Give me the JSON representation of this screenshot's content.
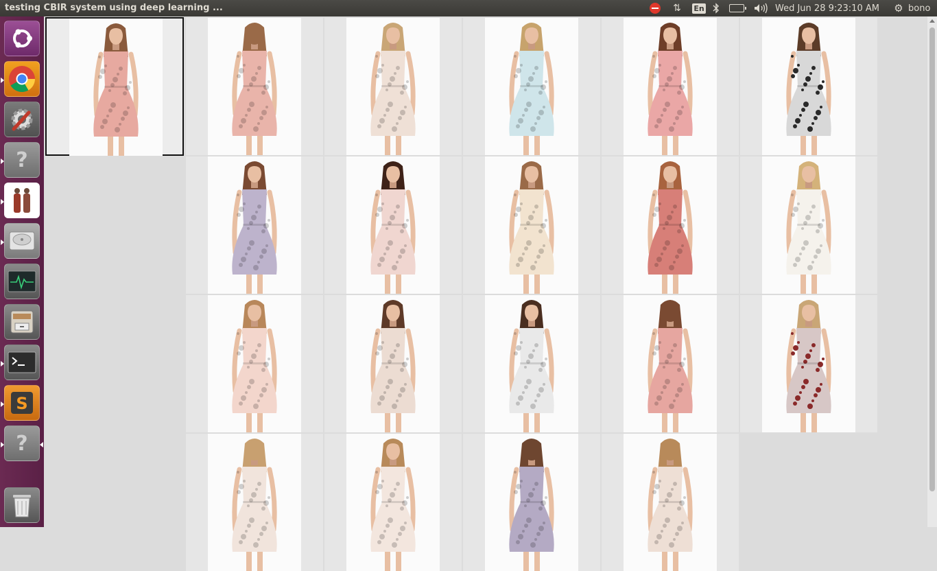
{
  "window": {
    "title": "testing CBIR system using deep learning ..."
  },
  "panel": {
    "keyboard_layout": "En",
    "clock": "Wed Jun 28  9:23:10 AM",
    "user": "bono",
    "indicators": [
      "stop-icon",
      "network-arrows-icon",
      "keyboard-icon",
      "bluetooth-icon",
      "battery-icon",
      "volume-icon",
      "session-gear-icon"
    ]
  },
  "launcher": [
    {
      "name": "ubuntu-dash-icon",
      "running": false
    },
    {
      "name": "chrome-icon",
      "running": true
    },
    {
      "name": "system-settings-icon",
      "running": false
    },
    {
      "name": "unknown-app-icon",
      "running": true
    },
    {
      "name": "image-viewer-icon",
      "running": true
    },
    {
      "name": "disk-icon",
      "running": true
    },
    {
      "name": "system-monitor-icon",
      "running": false
    },
    {
      "name": "file-cabinet-icon",
      "running": false
    },
    {
      "name": "terminal-icon",
      "running": true
    },
    {
      "name": "sublime-text-icon",
      "running": true
    },
    {
      "name": "unknown-app-icon",
      "running": true
    },
    {
      "name": "trash-icon",
      "running": false
    }
  ],
  "query": {
    "dress": "#e7a9a0",
    "hair": "#8a5a3c",
    "view": "front"
  },
  "results": [
    [
      {
        "dress": "#e9b4aa",
        "hair": "#9a6a48",
        "view": "back"
      },
      {
        "dress": "#efe0d6",
        "hair": "#c9a676",
        "view": "front"
      },
      {
        "dress": "#cfe5ea",
        "hair": "#c7a36c",
        "view": "front"
      },
      {
        "dress": "#eaa7a6",
        "hair": "#6e3e28",
        "view": "front"
      },
      {
        "dress": "#d8d8d8",
        "hair": "#5c3c28",
        "view": "front",
        "pattern": "#2a2a2a"
      }
    ],
    [
      {
        "dress": "#bdb3cc",
        "hair": "#7a4a32",
        "view": "front"
      },
      {
        "dress": "#f0d6d0",
        "hair": "#3e2218",
        "view": "front"
      },
      {
        "dress": "#f2e3cf",
        "hair": "#9a6a48",
        "view": "front"
      },
      {
        "dress": "#d77f78",
        "hair": "#a8633e",
        "view": "front"
      },
      {
        "dress": "#f5f2ec",
        "hair": "#d4b27a",
        "view": "front"
      }
    ],
    [
      {
        "dress": "#f3d6cc",
        "hair": "#b8875a",
        "view": "front"
      },
      {
        "dress": "#ecdcd2",
        "hair": "#5e3a28",
        "view": "front"
      },
      {
        "dress": "#e9e9e9",
        "hair": "#4a2e20",
        "view": "front"
      },
      {
        "dress": "#e6a6a0",
        "hair": "#7a4a32",
        "view": "back"
      },
      {
        "dress": "#d7c7c6",
        "hair": "#c9a676",
        "view": "front",
        "pattern": "#8a2a2a"
      }
    ],
    [
      {
        "dress": "#f1e4dc",
        "hair": "#c8a070",
        "view": "back"
      },
      {
        "dress": "#f3e6de",
        "hair": "#b88a5a",
        "view": "front"
      },
      {
        "dress": "#b4aac4",
        "hair": "#6e4630",
        "view": "back"
      },
      {
        "dress": "#eedfd5",
        "hair": "#b88a5a",
        "view": "back"
      }
    ]
  ]
}
